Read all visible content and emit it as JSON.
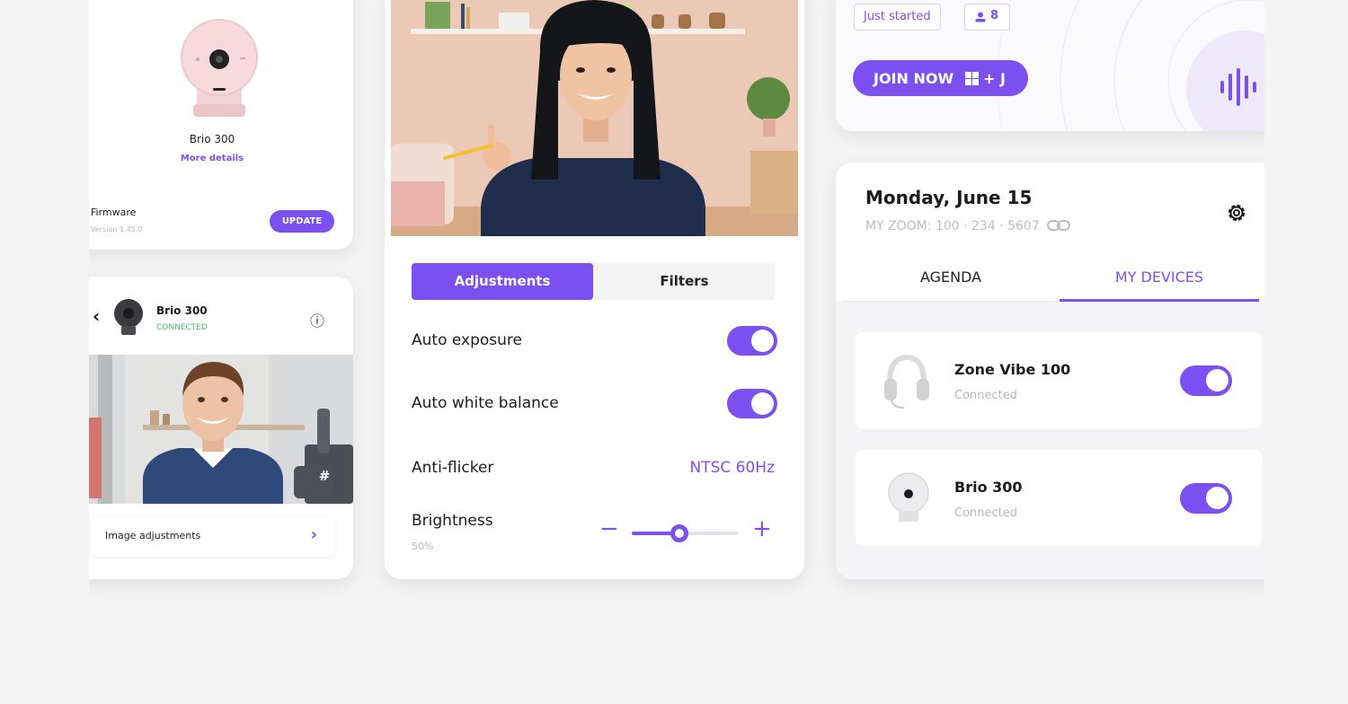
{
  "left_top": {
    "device_name": "Brio 300",
    "more_details": "More details",
    "firmware_label": "Firmware",
    "firmware_version": "Version 1.45.0",
    "update_label": "UPDATE"
  },
  "left_bottom": {
    "back_glyph": "‹",
    "device_name": "Brio 300",
    "status": "CONNECTED",
    "info_glyph": "ⓘ",
    "hash_glyph": "#",
    "image_adjustments_label": "Image adjustments",
    "chevron_glyph": "›"
  },
  "center": {
    "tabs": [
      {
        "label": "Adjustments",
        "active": true
      },
      {
        "label": "Filters",
        "active": false
      }
    ],
    "settings": {
      "auto_exposure": {
        "label": "Auto exposure",
        "on": true
      },
      "auto_white_balance": {
        "label": "Auto white balance",
        "on": true
      },
      "anti_flicker": {
        "label": "Anti-flicker",
        "value": "NTSC 60Hz"
      },
      "brightness": {
        "label": "Brightness",
        "value_text": "50%",
        "level": 0.45,
        "minus": "−",
        "plus": "+"
      }
    }
  },
  "right_top": {
    "badge_status": "Just started",
    "attendee_count": "8",
    "join_label": "JOIN NOW",
    "shortcut_plus_j": "+ J"
  },
  "right_bottom": {
    "date": "Monday, June 15",
    "zoom_line": "MY ZOOM: 100 · 234 · 5607",
    "tabs": [
      {
        "label": "AGENDA",
        "active": false
      },
      {
        "label": "MY DEVICES",
        "active": true
      }
    ],
    "devices": [
      {
        "name": "Zone Vibe 100",
        "status": "Connected",
        "on": true
      },
      {
        "name": "Brio 300",
        "status": "Connected",
        "on": true
      }
    ]
  },
  "colors": {
    "accent": "#7b4ff0",
    "connected_green": "#3ec46d",
    "background": "#f3f3f4"
  }
}
